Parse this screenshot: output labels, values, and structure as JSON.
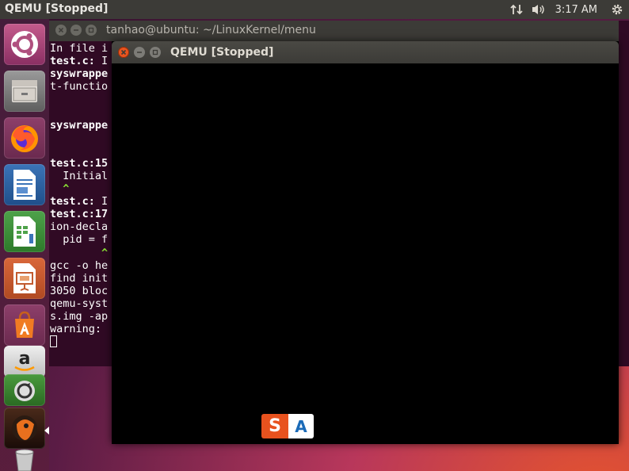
{
  "top_panel": {
    "title": "QEMU [Stopped]",
    "clock": "3:17 AM",
    "icons": [
      "network-arrows-icon",
      "volume-icon",
      "gear-icon"
    ]
  },
  "launcher": {
    "items": [
      "ubuntu-dash-icon",
      "files-icon",
      "firefox-icon",
      "writer-icon",
      "calc-icon",
      "impress-icon",
      "software-center-icon",
      "amazon-icon",
      "update-icon",
      "app-icon",
      "trash-icon"
    ]
  },
  "terminal": {
    "title": "tanhao@ubuntu: ~/LinuxKernel/menu",
    "lines": [
      {
        "text": "In file i",
        "style": ""
      },
      {
        "text": "test.c: I",
        "style": "mixed_test"
      },
      {
        "text": "syswrappe",
        "style": "b"
      },
      {
        "text": "t-functio",
        "style": ""
      },
      {
        "text": "",
        "style": ""
      },
      {
        "text": "",
        "style": ""
      },
      {
        "text": "syswrappe",
        "style": "b"
      },
      {
        "text": "",
        "style": ""
      },
      {
        "text": "",
        "style": ""
      },
      {
        "text": "test.c:15",
        "style": "b"
      },
      {
        "text": "  Initial",
        "style": ""
      },
      {
        "text": "  ^",
        "style": "g"
      },
      {
        "text": "test.c: I",
        "style": "mixed_test"
      },
      {
        "text": "test.c:17",
        "style": "b"
      },
      {
        "text": "ion-decla",
        "style": ""
      },
      {
        "text": "  pid = f",
        "style": ""
      },
      {
        "text": "        ^",
        "style": "g"
      },
      {
        "text": "gcc -o he",
        "style": ""
      },
      {
        "text": "find init",
        "style": ""
      },
      {
        "text": "3050 bloc",
        "style": ""
      },
      {
        "text": "qemu-syst",
        "style": ""
      },
      {
        "text": "s.img -ap",
        "style": ""
      },
      {
        "text": "warning: ",
        "style": ""
      }
    ]
  },
  "qemu": {
    "title": "QEMU [Stopped]"
  },
  "ime": {
    "s_label": "S",
    "a_label": "A"
  }
}
